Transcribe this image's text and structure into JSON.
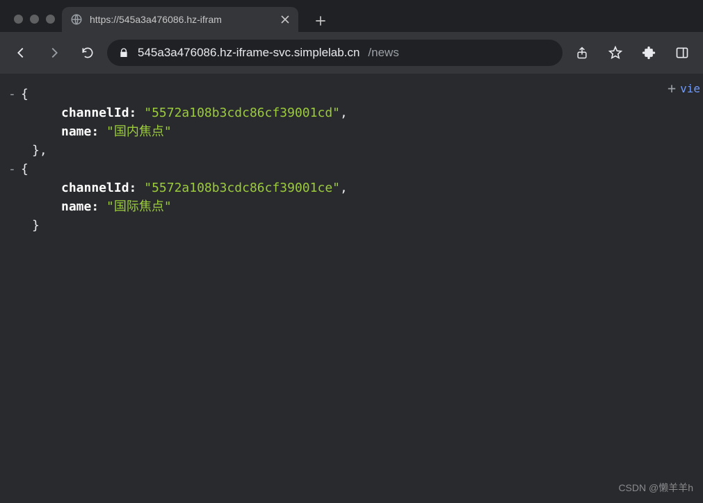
{
  "tab": {
    "title": "https://545a3a476086.hz-ifram"
  },
  "url": {
    "host": "545a3a476086.hz-iframe-svc.simplelab.cn",
    "path": "/news"
  },
  "viewer": {
    "plus_label": "+",
    "view_label_cut": "vie"
  },
  "json_items": [
    {
      "channelId_key": "channelId",
      "channelId_val": "\"5572a108b3cdc86cf39001cd\"",
      "name_key": "name",
      "name_val": "\"国内焦点\""
    },
    {
      "channelId_key": "channelId",
      "channelId_val": "\"5572a108b3cdc86cf39001ce\"",
      "name_key": "name",
      "name_val": "\"国际焦点\""
    }
  ],
  "delims": {
    "ob": "{",
    "cb": "}",
    "cbc": "},",
    "comma": ",",
    "colon": ": ",
    "minus": "-"
  },
  "watermark": "CSDN @懒羊羊h"
}
